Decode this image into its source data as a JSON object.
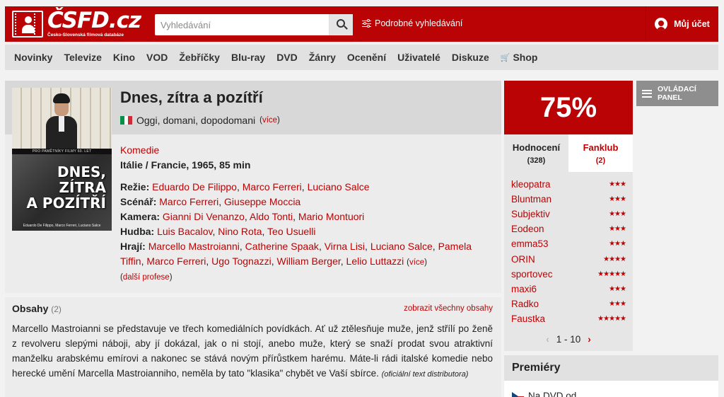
{
  "header": {
    "logo_text": "ČSFD.cz",
    "logo_subtitle": "Česko-Slovenská filmová databáze",
    "search_placeholder": "Vyhledávání",
    "advanced_search": "Podrobné vyhledávání",
    "account": "Můj účet",
    "brand_color": "#ba0305"
  },
  "nav": {
    "items": [
      "Novinky",
      "Televize",
      "Kino",
      "VOD",
      "Žebříčky",
      "Blu-ray",
      "DVD",
      "Žánry",
      "Ocenění",
      "Uživatelé",
      "Diskuze"
    ],
    "shop": "Shop"
  },
  "film": {
    "title": "Dnes, zítra a pozítří",
    "original_title": "Oggi, domani, dopodomani",
    "more_link": "více",
    "genre": "Komedie",
    "origin": "Itálie / Francie, 1965, 85 min",
    "poster": {
      "strip_text": "PRO PAMĚTNÍKY FILMY 60. LET",
      "title_lines": [
        "DNES,",
        "ZÍTRA",
        "A POZÍTŘÍ"
      ],
      "credits": "Eduardo De Filippo, Marco Ferreri, Luciano Salce"
    },
    "creators": {
      "rezie_label": "Režie:",
      "rezie": [
        "Eduardo De Filippo",
        "Marco Ferreri",
        "Luciano Salce"
      ],
      "scenar_label": "Scénář:",
      "scenar": [
        "Marco Ferreri",
        "Giuseppe Moccia"
      ],
      "kamera_label": "Kamera:",
      "kamera": [
        "Gianni Di Venanzo",
        "Aldo Tonti",
        "Mario Montuori"
      ],
      "hudba_label": "Hudba:",
      "hudba": [
        "Luis Bacalov",
        "Nino Rota",
        "Teo Usuelli"
      ],
      "hraji_label": "Hrají:",
      "hraji": [
        "Marcello Mastroianni",
        "Catherine Spaak",
        "Virna Lisi",
        "Luciano Salce",
        "Pamela Tiffin",
        "Marco Ferreri",
        "Ugo Tognazzi",
        "William Berger",
        "Lelio Luttazzi"
      ],
      "more_label": "více",
      "more_professions": "další profese"
    }
  },
  "plots": {
    "heading": "Obsahy",
    "count": "(2)",
    "show_all": "zobrazit všechny obsahy",
    "text": "Marcello Mastroianni se představuje ve třech komediálních povídkách. Ať už ztělesňuje muže, jenž střílí po ženě z revolveru slepými náboji, aby jí dokázal, jak o ni stojí, anebo muže, který se snaží prodat svou atraktivní manželku arabskému emírovi a nakonec se stává novým přírůstkem harému. Máte-li rádi italské komedie nebo herecké umění Marcella Mastroianniho, neměla by tato \"klasika\" chybět ve Vaší sbírce.",
    "source": "(oficiální text distributora)"
  },
  "rating": {
    "value": "75%",
    "tab_ratings": "Hodnocení",
    "tab_ratings_count": "(328)",
    "tab_fanclub": "Fanklub",
    "tab_fanclub_count": "(2)",
    "raters": [
      {
        "name": "kleopatra",
        "stars": 3
      },
      {
        "name": "Bluntman",
        "stars": 3
      },
      {
        "name": "Subjektiv",
        "stars": 3
      },
      {
        "name": "Eodeon",
        "stars": 3
      },
      {
        "name": "emma53",
        "stars": 3
      },
      {
        "name": "ORIN",
        "stars": 4
      },
      {
        "name": "sportovec",
        "stars": 5
      },
      {
        "name": "maxi6",
        "stars": 3
      },
      {
        "name": "Radko",
        "stars": 3
      },
      {
        "name": "Faustka",
        "stars": 5
      }
    ],
    "pager": "1 - 10"
  },
  "premieres": {
    "heading": "Premiéry",
    "item": "Na DVD od"
  },
  "control_panel": {
    "line1": "OVLÁDACÍ",
    "line2": "PANEL"
  }
}
